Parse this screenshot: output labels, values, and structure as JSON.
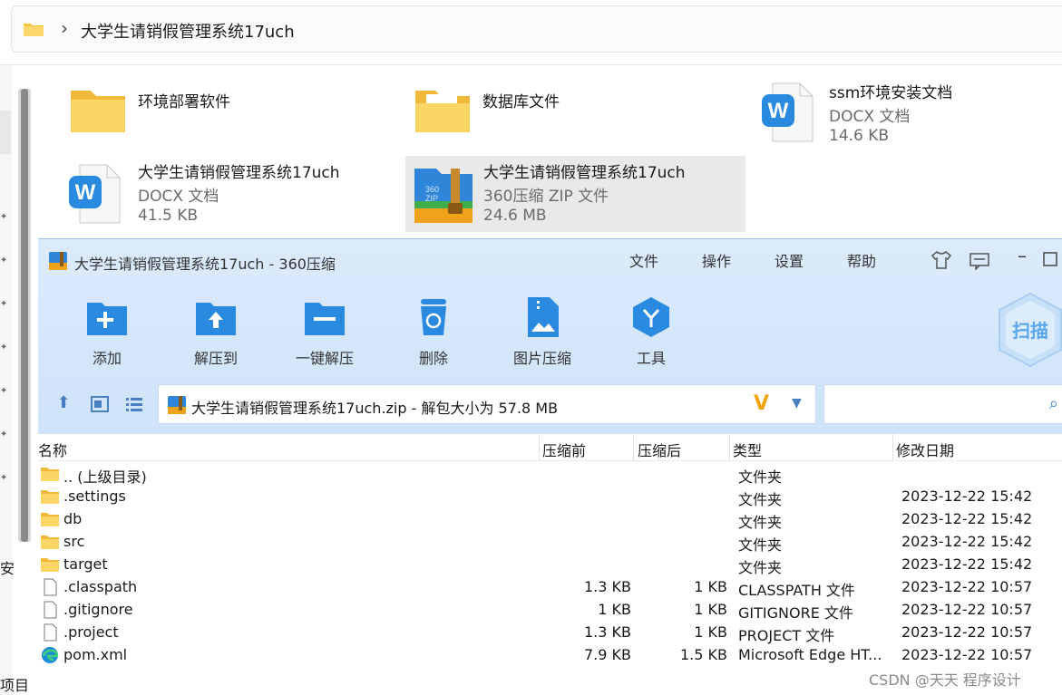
{
  "explorer": {
    "address_path": "大学生请销假管理系统17uch",
    "left_fragments": [
      "安",
      "项目"
    ],
    "tiles": [
      {
        "name": "环境部署软件",
        "type": "",
        "size": "",
        "icon": "folder-icon"
      },
      {
        "name": "数据库文件",
        "type": "",
        "size": "",
        "icon": "folder-icon"
      },
      {
        "name": "ssm环境安装文档",
        "type": "DOCX 文档",
        "size": "14.6 KB",
        "icon": "word-doc-icon"
      },
      {
        "name": "大学生请销假管理系统17uch",
        "type": "DOCX 文档",
        "size": "41.5 KB",
        "icon": "word-doc-icon"
      },
      {
        "name": "大学生请销假管理系统17uch",
        "type": "360压缩 ZIP 文件",
        "size": "24.6 MB",
        "icon": "zip-archive-icon"
      }
    ]
  },
  "zipwin": {
    "title": "大学生请销假管理系统17uch - 360压缩",
    "menu": [
      "文件",
      "操作",
      "设置",
      "帮助"
    ],
    "tools": [
      {
        "label": "添加",
        "icon": "add-folder-icon"
      },
      {
        "label": "解压到",
        "icon": "extract-to-icon"
      },
      {
        "label": "一键解压",
        "icon": "one-click-extract-icon"
      },
      {
        "label": "删除",
        "icon": "trash-icon"
      },
      {
        "label": "图片压缩",
        "icon": "image-compress-icon"
      },
      {
        "label": "工具",
        "icon": "tools-icon"
      }
    ],
    "scan_label": "扫描",
    "path": "大学生请销假管理系统17uch.zip - 解包大小为 57.8 MB",
    "columns": [
      "名称",
      "压缩前",
      "压缩后",
      "类型",
      "修改日期"
    ],
    "rows": [
      {
        "name": ".. (上级目录)",
        "before": "",
        "after": "",
        "type": "文件夹",
        "date": "",
        "icon": "folder-icon"
      },
      {
        "name": ".settings",
        "before": "",
        "after": "",
        "type": "文件夹",
        "date": "2023-12-22 15:42",
        "icon": "folder-icon"
      },
      {
        "name": "db",
        "before": "",
        "after": "",
        "type": "文件夹",
        "date": "2023-12-22 15:42",
        "icon": "folder-icon"
      },
      {
        "name": "src",
        "before": "",
        "after": "",
        "type": "文件夹",
        "date": "2023-12-22 15:42",
        "icon": "folder-icon"
      },
      {
        "name": "target",
        "before": "",
        "after": "",
        "type": "文件夹",
        "date": "2023-12-22 15:42",
        "icon": "folder-icon"
      },
      {
        "name": ".classpath",
        "before": "1.3 KB",
        "after": "1 KB",
        "type": "CLASSPATH 文件",
        "date": "2023-12-22 10:57",
        "icon": "file-icon"
      },
      {
        "name": ".gitignore",
        "before": "1 KB",
        "after": "1 KB",
        "type": "GITIGNORE 文件",
        "date": "2023-12-22 10:57",
        "icon": "file-icon"
      },
      {
        "name": ".project",
        "before": "1.3 KB",
        "after": "1 KB",
        "type": "PROJECT 文件",
        "date": "2023-12-22 10:57",
        "icon": "file-icon"
      },
      {
        "name": "pom.xml",
        "before": "7.9 KB",
        "after": "1.5 KB",
        "type": "Microsoft Edge HT...",
        "date": "2023-12-22 10:57",
        "icon": "edge-icon"
      }
    ]
  },
  "watermark": "CSDN @天天 程序设计",
  "colors": {
    "accent": "#2a8ae0",
    "folder": "#f6c344",
    "toolbar_bg": "#d4e6fa"
  }
}
